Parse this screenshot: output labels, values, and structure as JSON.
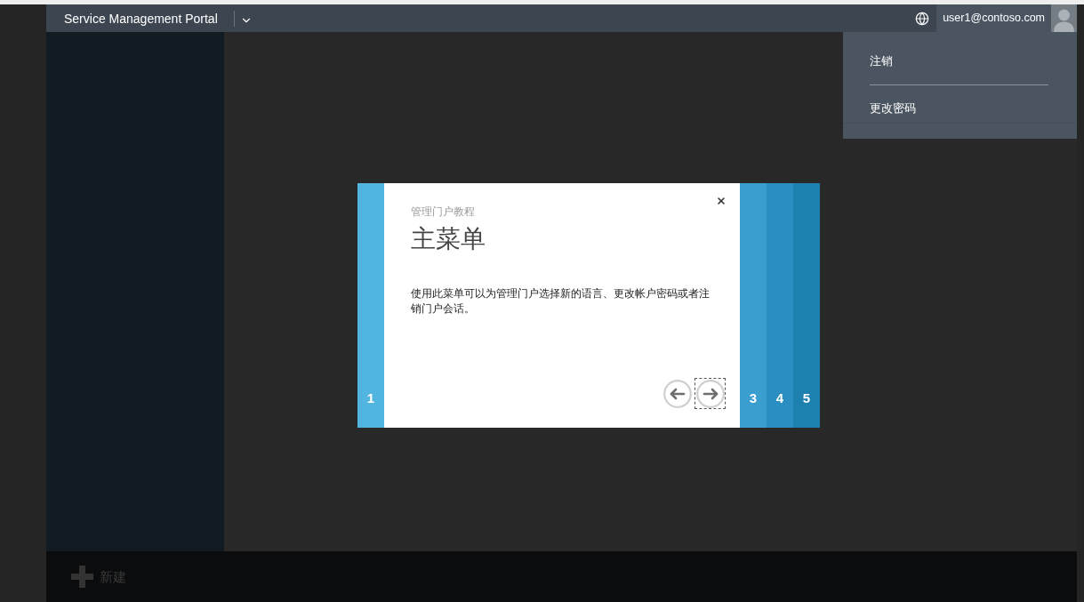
{
  "header": {
    "title": "Service Management Portal",
    "user": "user1@contoso.com"
  },
  "user_menu": {
    "items": [
      {
        "label": "注销"
      },
      {
        "label": "更改密码"
      }
    ]
  },
  "tutorial": {
    "subtitle": "管理门户教程",
    "title": "主菜单",
    "body": "使用此菜单可以为管理门户选择新的语言、更改帐户密码或者注销门户会话。",
    "steps_before": [
      {
        "label": "1",
        "color": "#52b5e0"
      }
    ],
    "steps_after": [
      {
        "label": "3",
        "color": "#3a9ecf"
      },
      {
        "label": "4",
        "color": "#2b8ec0"
      },
      {
        "label": "5",
        "color": "#1e80af"
      }
    ],
    "nav_buttons": [
      {
        "kind": "prev",
        "focused": false
      },
      {
        "kind": "next",
        "focused": true
      }
    ]
  },
  "command_bar": {
    "items": [
      {
        "label": "新建"
      }
    ]
  }
}
